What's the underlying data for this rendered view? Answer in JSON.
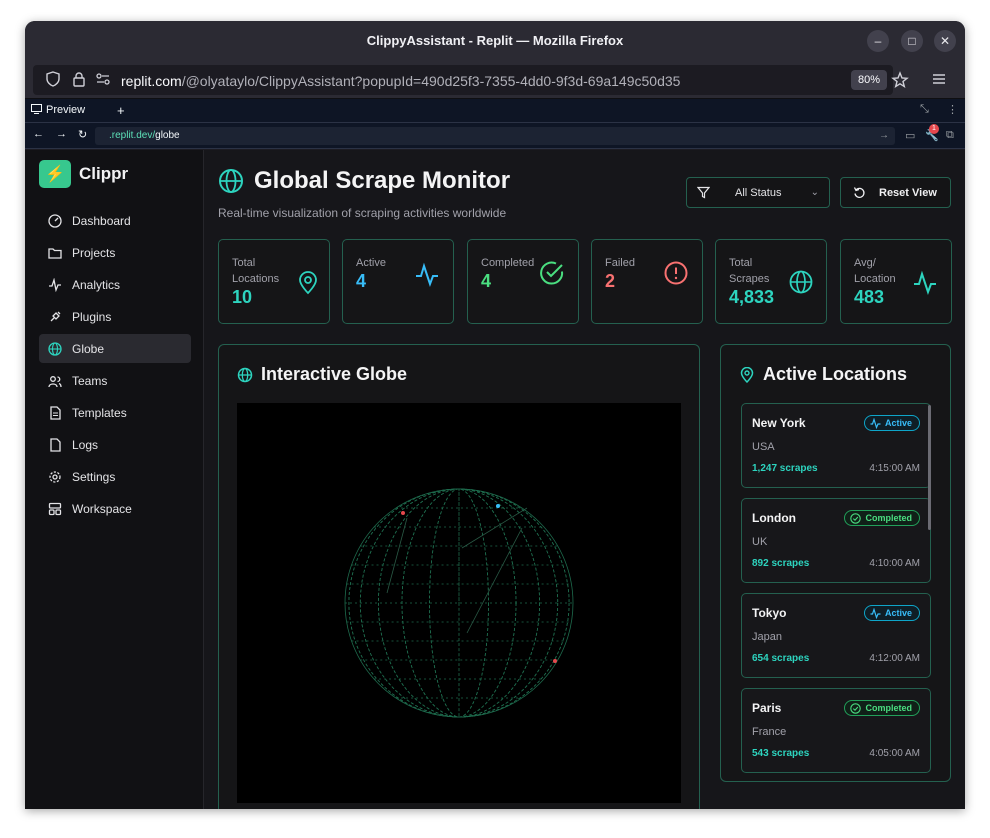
{
  "browser": {
    "title": "ClippyAssistant - Replit — Mozilla Firefox",
    "url_host": "replit.com",
    "url_path": "/@olyataylo/ClippyAssistant?popupId=490d25f3-7355-4dd0-9f3d-69a149c50d35",
    "zoom": "80%"
  },
  "preview": {
    "tab_label": "Preview",
    "add_tab": "+",
    "url_prefix": ".replit.dev/",
    "url_page": "globe",
    "notification_count": "1"
  },
  "sidebar": {
    "brand": "Clippr",
    "items": [
      {
        "label": "Dashboard",
        "icon": "gauge-icon"
      },
      {
        "label": "Projects",
        "icon": "folder-icon"
      },
      {
        "label": "Analytics",
        "icon": "activity-icon"
      },
      {
        "label": "Plugins",
        "icon": "plug-icon"
      },
      {
        "label": "Globe",
        "icon": "globe-icon",
        "active": true
      },
      {
        "label": "Teams",
        "icon": "users-icon"
      },
      {
        "label": "Templates",
        "icon": "file-icon"
      },
      {
        "label": "Logs",
        "icon": "log-icon"
      },
      {
        "label": "Settings",
        "icon": "gear-icon"
      },
      {
        "label": "Workspace",
        "icon": "layout-icon"
      }
    ]
  },
  "header": {
    "title": "Global Scrape Monitor",
    "subtitle": "Real-time visualization of scraping activities worldwide",
    "status_filter": "All Status",
    "reset_label": "Reset View"
  },
  "stats": [
    {
      "label": "Total Locations",
      "value": "10",
      "color": "#2dd4bf"
    },
    {
      "label": "Active",
      "value": "4",
      "color": "#38bdf8"
    },
    {
      "label": "Completed",
      "value": "4",
      "color": "#4ade80"
    },
    {
      "label": "Failed",
      "value": "2",
      "color": "#f87171"
    },
    {
      "label": "Total Scrapes",
      "value": "4,833",
      "color": "#2dd4bf"
    },
    {
      "label": "Avg/ Location",
      "value": "483",
      "color": "#2dd4bf"
    }
  ],
  "globe_panel": {
    "title": "Interactive Globe"
  },
  "locations_panel": {
    "title": "Active Locations",
    "items": [
      {
        "city": "New York",
        "country": "USA",
        "scrapes": "1,247 scrapes",
        "time": "4:15:00 AM",
        "status": "Active"
      },
      {
        "city": "London",
        "country": "UK",
        "scrapes": "892 scrapes",
        "time": "4:10:00 AM",
        "status": "Completed"
      },
      {
        "city": "Tokyo",
        "country": "Japan",
        "scrapes": "654 scrapes",
        "time": "4:12:00 AM",
        "status": "Active"
      },
      {
        "city": "Paris",
        "country": "France",
        "scrapes": "543 scrapes",
        "time": "4:05:00 AM",
        "status": "Completed"
      }
    ]
  },
  "colors": {
    "accent": "#2dd4bf",
    "border": "#24604f",
    "active": "#38bdf8",
    "completed": "#4ade80",
    "failed": "#f87171"
  }
}
